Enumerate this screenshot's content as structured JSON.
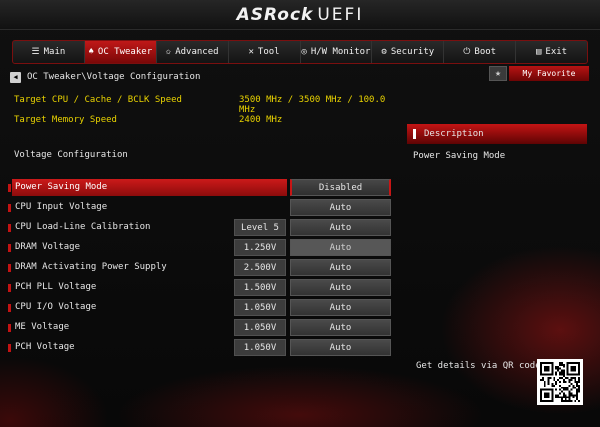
{
  "app": {
    "brand": "ASRock",
    "product": "UEFI"
  },
  "menu": [
    {
      "label": "Main",
      "icon": "list-icon",
      "glyph": "☰",
      "active": false
    },
    {
      "label": "OC Tweaker",
      "icon": "flame-icon",
      "glyph": "♠",
      "active": true
    },
    {
      "label": "Advanced",
      "icon": "star-icon",
      "glyph": "✩",
      "active": false
    },
    {
      "label": "Tool",
      "icon": "tools-icon",
      "glyph": "✕",
      "active": false
    },
    {
      "label": "H/W Monitor",
      "icon": "monitor-icon",
      "glyph": "◎",
      "active": false
    },
    {
      "label": "Security",
      "icon": "shield-icon",
      "glyph": "⚙",
      "active": false
    },
    {
      "label": "Boot",
      "icon": "power-icon",
      "glyph": "⏻",
      "active": false
    },
    {
      "label": "Exit",
      "icon": "exit-icon",
      "glyph": "▤",
      "active": false
    }
  ],
  "breadcrumb": "OC Tweaker\\Voltage Configuration",
  "favorite": {
    "label": "My Favorite"
  },
  "info": [
    {
      "label": "Target CPU / Cache / BCLK Speed",
      "value": "3500 MHz / 3500 MHz / 100.0 MHz"
    },
    {
      "label": "Target Memory Speed",
      "value": "2400 MHz"
    }
  ],
  "section_title": "Voltage Configuration",
  "settings": [
    {
      "label": "Power Saving Mode",
      "value": "",
      "option": "Disabled",
      "selected": true,
      "dim": false
    },
    {
      "label": "CPU Input Voltage",
      "value": "",
      "option": "Auto",
      "selected": false,
      "dim": false
    },
    {
      "label": "CPU Load-Line Calibration",
      "value": "Level 5",
      "option": "Auto",
      "selected": false,
      "dim": false
    },
    {
      "label": "DRAM Voltage",
      "value": "1.250V",
      "option": "Auto",
      "selected": false,
      "dim": true
    },
    {
      "label": "DRAM Activating Power Supply",
      "value": "2.500V",
      "option": "Auto",
      "selected": false,
      "dim": false
    },
    {
      "label": "PCH PLL Voltage",
      "value": "1.500V",
      "option": "Auto",
      "selected": false,
      "dim": false
    },
    {
      "label": "CPU I/O Voltage",
      "value": "1.050V",
      "option": "Auto",
      "selected": false,
      "dim": false
    },
    {
      "label": "ME Voltage",
      "value": "1.050V",
      "option": "Auto",
      "selected": false,
      "dim": false
    },
    {
      "label": "PCH Voltage",
      "value": "1.050V",
      "option": "Auto",
      "selected": false,
      "dim": false
    }
  ],
  "description": {
    "title": "Description",
    "text": "Power Saving Mode"
  },
  "qr": {
    "label": "Get details via QR code",
    "icon": "qr-code-icon"
  },
  "colors": {
    "accent": "#c21313",
    "info_text": "#e8d200",
    "background": "#0c0c0c"
  }
}
